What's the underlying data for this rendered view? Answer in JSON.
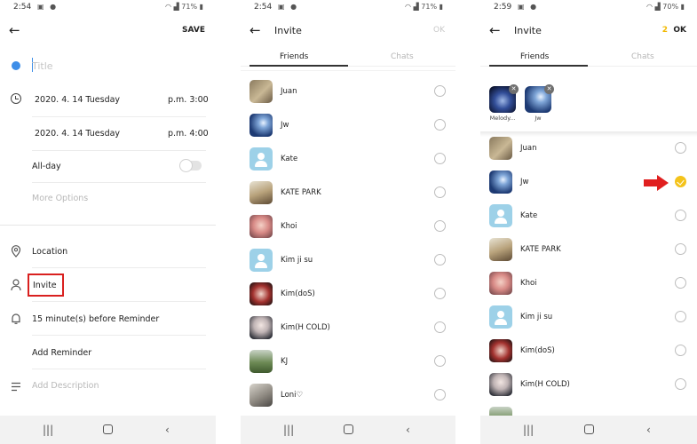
{
  "colors": {
    "accent_blue": "#3d8ee8",
    "highlight_red": "#d9201f",
    "check_yellow": "#f4c31b",
    "count_yellow": "#f1b800"
  },
  "screen1": {
    "status": {
      "time": "2:54",
      "battery": "71%"
    },
    "header": {
      "save_label": "SAVE"
    },
    "title_placeholder": "Title",
    "start": {
      "date": "2020. 4. 14 Tuesday",
      "time": "p.m. 3:00"
    },
    "end": {
      "date": "2020. 4. 14 Tuesday",
      "time": "p.m. 4:00"
    },
    "all_day_label": "All-day",
    "all_day_on": false,
    "more_options_label": "More Options",
    "location_label": "Location",
    "invite_label": "Invite",
    "reminder_label": "15 minute(s) before Reminder",
    "add_reminder_label": "Add Reminder",
    "add_description_placeholder": "Add Description"
  },
  "screen2": {
    "status": {
      "time": "2:54",
      "battery": "71%"
    },
    "header": {
      "title": "Invite",
      "ok_label": "OK"
    },
    "tabs": [
      {
        "label": "Friends",
        "active": true
      },
      {
        "label": "Chats",
        "active": false
      }
    ],
    "friends": [
      {
        "name": "Juan",
        "avatar": "photo-group",
        "checked": false
      },
      {
        "name": "Jw",
        "avatar": "photo-blue",
        "checked": false
      },
      {
        "name": "Kate",
        "avatar": "default",
        "checked": false
      },
      {
        "name": "KATE PARK",
        "avatar": "photo-tree",
        "checked": false
      },
      {
        "name": "Khoi",
        "avatar": "photo-pink",
        "checked": false
      },
      {
        "name": "Kim ji su",
        "avatar": "default",
        "checked": false
      },
      {
        "name": "Kim(doS)",
        "avatar": "photo-red",
        "checked": false
      },
      {
        "name": "Kim(H COLD)",
        "avatar": "photo-face",
        "checked": false
      },
      {
        "name": "KJ",
        "avatar": "photo-field",
        "checked": false
      },
      {
        "name": "Loni♡",
        "avatar": "photo-gray",
        "checked": false
      }
    ]
  },
  "screen3": {
    "status": {
      "time": "2:59",
      "battery": "70%"
    },
    "header": {
      "title": "Invite",
      "count": "2",
      "ok_label": "OK"
    },
    "tabs": [
      {
        "label": "Friends",
        "active": true
      },
      {
        "label": "Chats",
        "active": false
      }
    ],
    "selected": [
      {
        "name": "Melody...",
        "avatar": "photo-dark"
      },
      {
        "name": "Jw",
        "avatar": "photo-blue"
      }
    ],
    "friends": [
      {
        "name": "Juan",
        "avatar": "photo-group",
        "checked": false
      },
      {
        "name": "Jw",
        "avatar": "photo-blue",
        "checked": true
      },
      {
        "name": "Kate",
        "avatar": "default",
        "checked": false
      },
      {
        "name": "KATE PARK",
        "avatar": "photo-tree",
        "checked": false
      },
      {
        "name": "Khoi",
        "avatar": "photo-pink",
        "checked": false
      },
      {
        "name": "Kim ji su",
        "avatar": "default",
        "checked": false
      },
      {
        "name": "Kim(doS)",
        "avatar": "photo-red",
        "checked": false
      },
      {
        "name": "Kim(H COLD)",
        "avatar": "photo-face",
        "checked": false
      }
    ]
  }
}
